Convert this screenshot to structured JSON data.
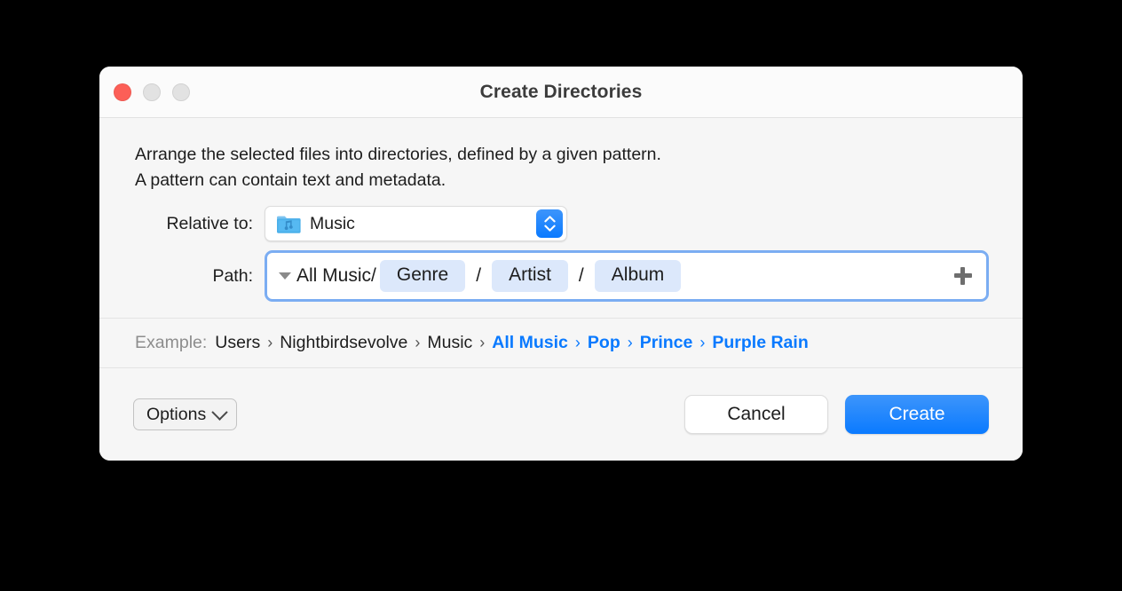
{
  "window": {
    "title": "Create Directories",
    "traffic_lights": [
      {
        "name": "close",
        "color": "#fc5f57"
      },
      {
        "name": "minimize",
        "color": "#e2e2e2"
      },
      {
        "name": "zoom",
        "color": "#e2e2e2"
      }
    ]
  },
  "description": {
    "line1": "Arrange the selected files into directories, defined by a given pattern.",
    "line2": "A pattern can contain text and metadata."
  },
  "relative_to": {
    "label": "Relative to:",
    "value": "Music",
    "icon": "music-folder-icon"
  },
  "path": {
    "label": "Path:",
    "prefix": "All Music/",
    "tokens": [
      "Genre",
      "Artist",
      "Album"
    ],
    "separator": "/",
    "add_icon": "plus-icon",
    "disclosure_icon": "triangle-down-icon"
  },
  "example": {
    "label": "Example:",
    "separator": "›",
    "crumbs": [
      {
        "text": "Users",
        "highlight": false
      },
      {
        "text": "Nightbirdsevolve",
        "highlight": false
      },
      {
        "text": "Music",
        "highlight": false
      },
      {
        "text": "All Music",
        "highlight": true
      },
      {
        "text": "Pop",
        "highlight": true
      },
      {
        "text": "Prince",
        "highlight": true
      },
      {
        "text": "Purple Rain",
        "highlight": true
      }
    ]
  },
  "footer": {
    "options_label": "Options",
    "cancel_label": "Cancel",
    "create_label": "Create"
  },
  "colors": {
    "accent": "#0a7aff",
    "token_background": "#dce8fb",
    "focus_ring": "#7badf2",
    "muted_text": "#8d8d8d"
  }
}
